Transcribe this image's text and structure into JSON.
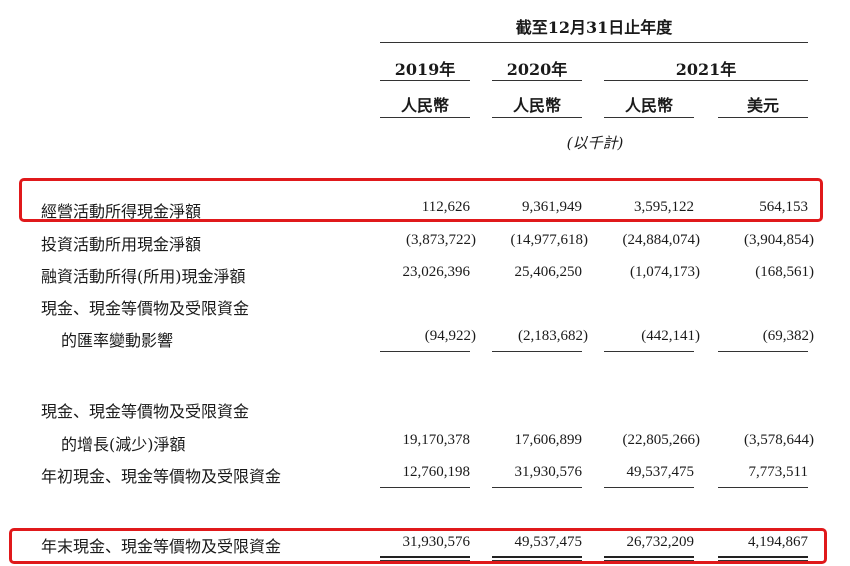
{
  "header": {
    "period": "截至12月31日止年度",
    "years": [
      "2019年",
      "2020年",
      "2021年"
    ],
    "currencies": [
      "人民幣",
      "人民幣",
      "人民幣",
      "美元"
    ],
    "units": "(以千計)"
  },
  "rows": [
    {
      "label": "經營活動所得現金淨額",
      "values": [
        "112,626",
        "9,361,949",
        "3,595,122",
        "564,153"
      ]
    },
    {
      "label": "投資活動所用現金淨額",
      "values": [
        "(3,873,722)",
        "(14,977,618)",
        "(24,884,074)",
        "(3,904,854)"
      ]
    },
    {
      "label": "融資活動所得(所用)現金淨額",
      "values": [
        "23,026,396",
        "25,406,250",
        "(1,074,173)",
        "(168,561)"
      ]
    },
    {
      "label": "現金、現金等價物及受限資金",
      "label2": "的匯率變動影響",
      "values": [
        "(94,922)",
        "(2,183,682)",
        "(442,141)",
        "(69,382)"
      ]
    },
    {
      "label": "現金、現金等價物及受限資金",
      "label2": "的增長(減少)淨額",
      "values": [
        "19,170,378",
        "17,606,899",
        "(22,805,266)",
        "(3,578,644)"
      ]
    },
    {
      "label": "年初現金、現金等價物及受限資金",
      "values": [
        "12,760,198",
        "31,930,576",
        "49,537,475",
        "7,773,511"
      ]
    },
    {
      "label": "年末現金、現金等價物及受限資金",
      "values": [
        "31,930,576",
        "49,537,475",
        "26,732,209",
        "4,194,867"
      ]
    }
  ],
  "highlight_color": "#e0191b"
}
